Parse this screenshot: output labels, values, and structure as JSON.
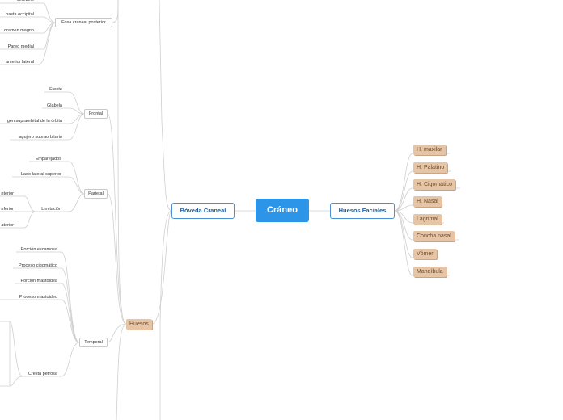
{
  "root": "Cráneo",
  "left_branch": "Bóveda Craneal",
  "right_branch": "Huesos Faciales",
  "huesos": "Huesos",
  "facial_bones": [
    "H. maxilar",
    "H. Palatino",
    "H. Cigomático",
    "H. Nasal",
    "Lagrimal",
    "Concha nasal",
    "Vómer",
    "Mandíbula"
  ],
  "fosa": {
    "label": "Fosa craneal posterior",
    "items": [
      "cerebelo",
      "hasta occipital",
      "oramen magno",
      "Pared medial",
      "anterior lateral"
    ]
  },
  "frontal": {
    "label": "Frontal",
    "items": [
      "Frente",
      "Glabela",
      "gen supraorbital de la órbita",
      "agujero supraorbitario"
    ]
  },
  "parietal": {
    "label": "Parietal",
    "items": [
      "Emparejados",
      "Lado lateral superior",
      "Limitación"
    ],
    "limit_items": [
      "nterior",
      "nferior",
      "aterior"
    ]
  },
  "temporal": {
    "label": "Temporal",
    "items": [
      "Porción escamosa",
      "Proceso cigomático",
      "Porción mastoidea",
      "Proceso mastoideo",
      "Cresta petrosa"
    ]
  },
  "colors": {
    "root": "#2c95e8",
    "main_border": "#4a90d6",
    "tan": "#e6c5a7",
    "line": "#c8c8c8"
  }
}
